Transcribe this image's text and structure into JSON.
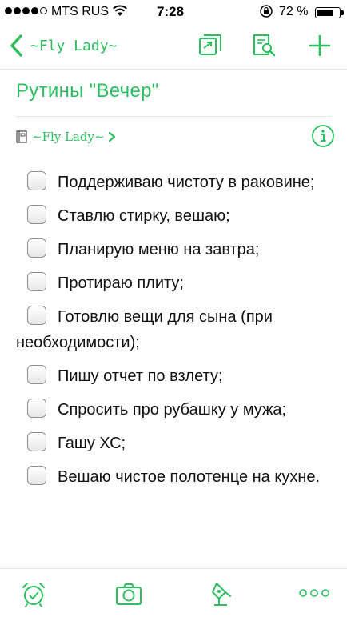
{
  "status_bar": {
    "carrier": "MTS RUS",
    "time": "7:28",
    "battery_percent": "72 %",
    "battery_level": 0.72,
    "signal_bars_filled": 4,
    "signal_bars_total": 5,
    "icons": [
      "wifi-icon",
      "rotation-lock-icon",
      "battery-icon"
    ]
  },
  "nav": {
    "back_label": "~Fly Lady~",
    "icons": [
      "back-chevron-icon",
      "move-note-icon",
      "find-in-note-icon",
      "add-icon"
    ]
  },
  "note": {
    "title": "Рутины \"Вечер\"",
    "notebook": "~Fly Lady~",
    "checklist": [
      {
        "text": "Поддерживаю чистоту в раковине;",
        "checked": false
      },
      {
        "text": "Ставлю стирку, вешаю;",
        "checked": false
      },
      {
        "text": "Планирую меню на завтра;",
        "checked": false
      },
      {
        "text": "Протираю плиту;",
        "checked": false
      },
      {
        "text": "Готовлю вещи для сына (при необходимости);",
        "checked": false
      },
      {
        "text": "Пишу отчет по взлету;",
        "checked": false
      },
      {
        "text": "Спросить про рубашку у мужа;",
        "checked": false
      },
      {
        "text": "Гашу ХС;",
        "checked": false
      },
      {
        "text": "Вешаю чистое полотенце на кухне.",
        "checked": false
      }
    ]
  },
  "toolbar": {
    "icons": [
      "reminder-alarm-icon",
      "camera-icon",
      "draw-pen-icon",
      "more-icon"
    ]
  },
  "colors": {
    "accent": "#2dbe60",
    "text": "#111111",
    "divider": "#e4e4e4"
  }
}
